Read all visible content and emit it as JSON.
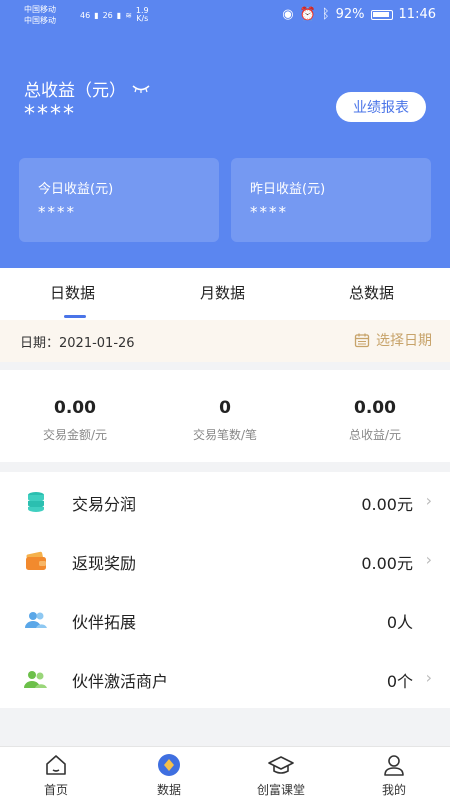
{
  "status_bar": {
    "carrier1": "中国移动",
    "carrier2": "中国移动",
    "network": "46",
    "network2": "26",
    "speed": "1.9",
    "speed_unit": "K/s",
    "battery": "92%",
    "time": "11:46"
  },
  "header": {
    "total_label": "总收益（元）",
    "total_value": "****",
    "report_button": "业绩报表"
  },
  "cards": [
    {
      "label": "今日收益(元)",
      "value": "****"
    },
    {
      "label": "昨日收益(元)",
      "value": "****"
    }
  ],
  "tabs": [
    {
      "label": "日数据",
      "active": true
    },
    {
      "label": "月数据",
      "active": false
    },
    {
      "label": "总数据",
      "active": false
    }
  ],
  "date_row": {
    "date_text": "日期：2021-01-26",
    "pick_label": "选择日期"
  },
  "stats": [
    {
      "value": "0.00",
      "label": "交易金额/元"
    },
    {
      "value": "0",
      "label": "交易笔数/笔"
    },
    {
      "value": "0.00",
      "label": "总收益/元"
    }
  ],
  "list": [
    {
      "label": "交易分润",
      "value": "0.00元",
      "icon": "coins-icon",
      "chevron": true
    },
    {
      "label": "返现奖励",
      "value": "0.00元",
      "icon": "wallet-icon",
      "chevron": true
    },
    {
      "label": "伙伴拓展",
      "value": "0人",
      "icon": "partners-icon",
      "chevron": false
    },
    {
      "label": "伙伴激活商户",
      "value": "0个",
      "icon": "merchants-icon",
      "chevron": true
    }
  ],
  "bottom_nav": [
    {
      "label": "首页",
      "icon": "home-icon"
    },
    {
      "label": "数据",
      "icon": "data-icon"
    },
    {
      "label": "创富课堂",
      "icon": "graduation-cap-icon"
    },
    {
      "label": "我的",
      "icon": "user-icon"
    }
  ],
  "colors": {
    "header_bg": "#5b86f0",
    "accent": "#4a74e8",
    "date_accent": "#c7a36a"
  }
}
